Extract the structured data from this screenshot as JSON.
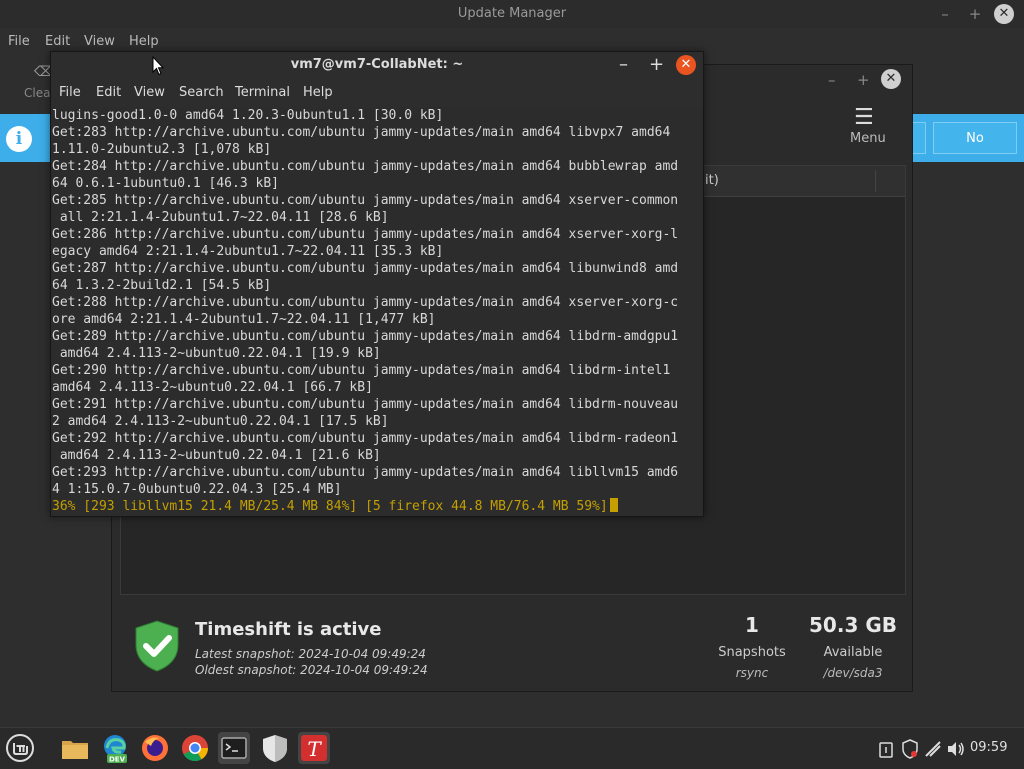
{
  "update_manager": {
    "title": "Update Manager",
    "menu": [
      "File",
      "Edit",
      "View",
      "Help"
    ],
    "clear_label": "Clea",
    "info_no_button": "No"
  },
  "timeshift": {
    "menu_label": "Menu",
    "column_partial": "it)",
    "status_title": "Timeshift is active",
    "latest": "Latest snapshot: 2024-10-04 09:49:24",
    "oldest": "Oldest snapshot: 2024-10-04 09:49:24",
    "snapshots_count": "1",
    "snapshots_label": "Snapshots",
    "snapshots_type": "rsync",
    "available_size": "50.3 GB",
    "available_label": "Available",
    "available_device": "/dev/sda3"
  },
  "terminal": {
    "title": "vm7@vm7-CollabNet: ~",
    "menu": [
      "File",
      "Edit",
      "View",
      "Search",
      "Terminal",
      "Help"
    ],
    "lines": [
      "lugins-good1.0-0 amd64 1.20.3-0ubuntu1.1 [30.0 kB]",
      "Get:283 http://archive.ubuntu.com/ubuntu jammy-updates/main amd64 libvpx7 amd64",
      "1.11.0-2ubuntu2.3 [1,078 kB]",
      "Get:284 http://archive.ubuntu.com/ubuntu jammy-updates/main amd64 bubblewrap amd",
      "64 0.6.1-1ubuntu0.1 [46.3 kB]",
      "Get:285 http://archive.ubuntu.com/ubuntu jammy-updates/main amd64 xserver-common",
      " all 2:21.1.4-2ubuntu1.7~22.04.11 [28.6 kB]",
      "Get:286 http://archive.ubuntu.com/ubuntu jammy-updates/main amd64 xserver-xorg-l",
      "egacy amd64 2:21.1.4-2ubuntu1.7~22.04.11 [35.3 kB]",
      "Get:287 http://archive.ubuntu.com/ubuntu jammy-updates/main amd64 libunwind8 amd",
      "64 1.3.2-2build2.1 [54.5 kB]",
      "Get:288 http://archive.ubuntu.com/ubuntu jammy-updates/main amd64 xserver-xorg-c",
      "ore amd64 2:21.1.4-2ubuntu1.7~22.04.11 [1,477 kB]",
      "Get:289 http://archive.ubuntu.com/ubuntu jammy-updates/main amd64 libdrm-amdgpu1",
      " amd64 2.4.113-2~ubuntu0.22.04.1 [19.9 kB]",
      "Get:290 http://archive.ubuntu.com/ubuntu jammy-updates/main amd64 libdrm-intel1",
      "amd64 2.4.113-2~ubuntu0.22.04.1 [66.7 kB]",
      "Get:291 http://archive.ubuntu.com/ubuntu jammy-updates/main amd64 libdrm-nouveau",
      "2 amd64 2.4.113-2~ubuntu0.22.04.1 [17.5 kB]",
      "Get:292 http://archive.ubuntu.com/ubuntu jammy-updates/main amd64 libdrm-radeon1",
      " amd64 2.4.113-2~ubuntu0.22.04.1 [21.6 kB]",
      "Get:293 http://archive.ubuntu.com/ubuntu jammy-updates/main amd64 libllvm15 amd6",
      "4 1:15.0.7-0ubuntu0.22.04.3 [25.4 MB]"
    ],
    "progress_line": "36% [293 libllvm15 21.4 MB/25.4 MB 84%] [5 firefox 44.8 MB/76.4 MB 59%]"
  },
  "taskbar": {
    "clock": "09:59",
    "edge_badge": "DEV",
    "items": [
      "mint-menu-icon",
      "files-icon",
      "edge-dev-icon",
      "firefox-icon",
      "chrome-icon",
      "terminal-icon",
      "shield-app-icon",
      "typora-icon"
    ]
  },
  "colors": {
    "info_bar": "#3daee9",
    "terminal_close": "#e95420",
    "progress_text": "#c4a000",
    "timeshift_shield": "#4caf50"
  }
}
